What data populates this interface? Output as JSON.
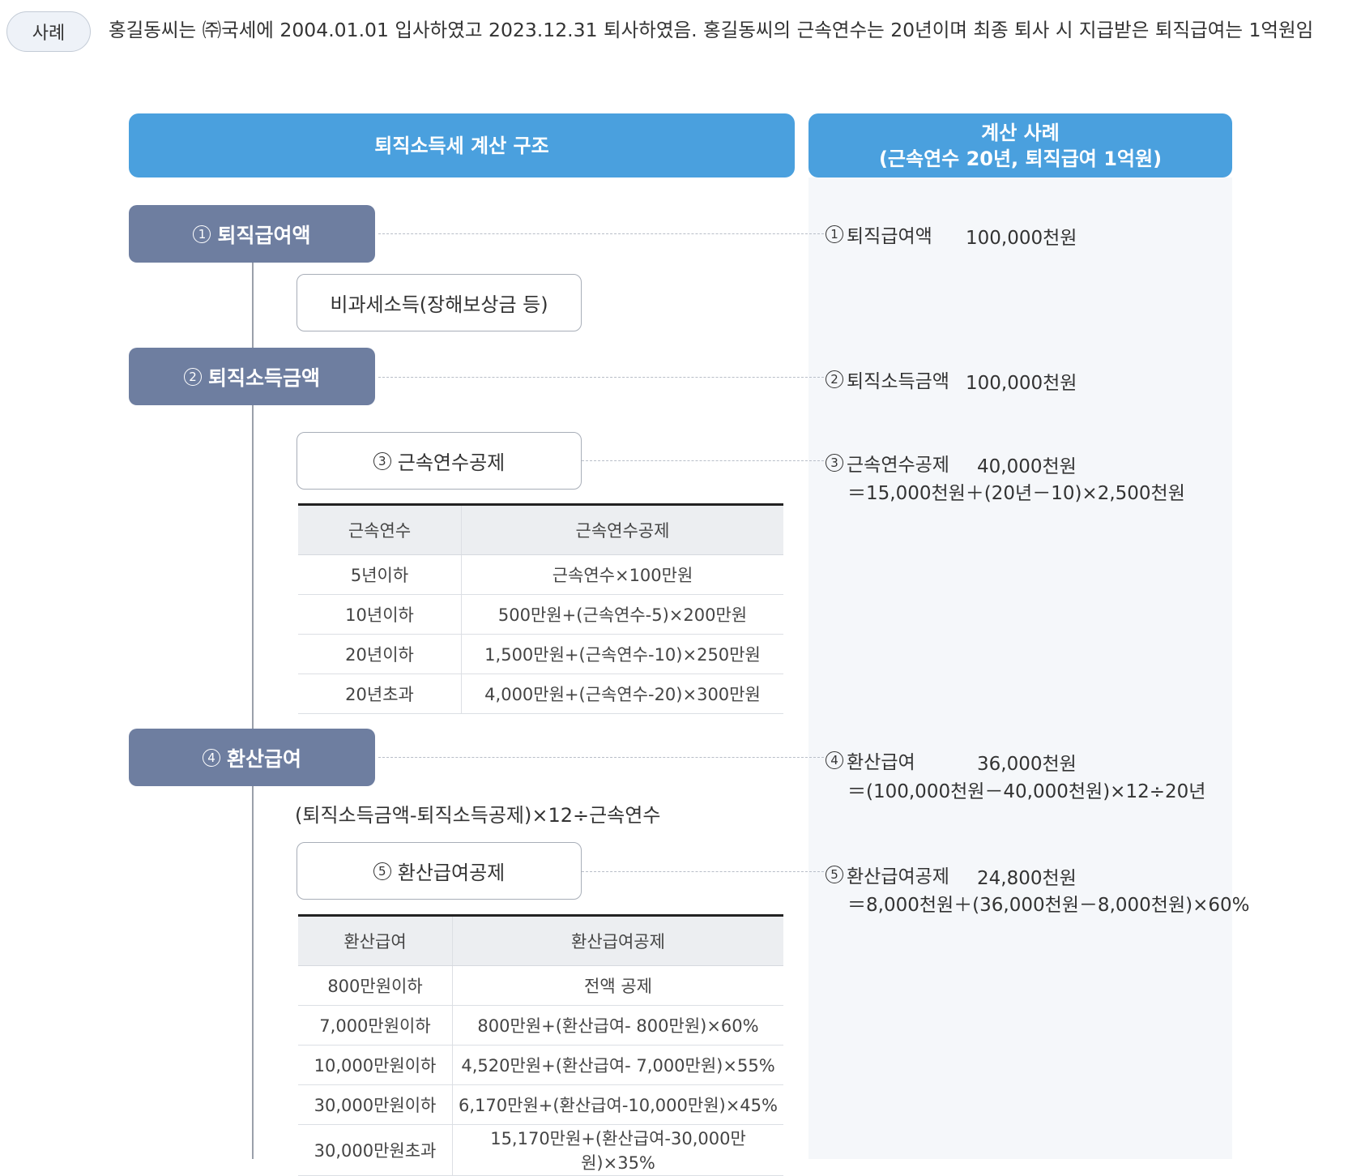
{
  "case": {
    "badge": "사례",
    "text": "홍길동씨는 ㈜국세에 2004.01.01 입사하였고 2023.12.31 퇴사하였음. 홍길동씨의 근속연수는 20년이며 최종 퇴사 시 지급받은 퇴직급여는 1억원임"
  },
  "headers": {
    "left": "퇴직소득세 계산 구조",
    "right_line1": "계산 사례",
    "right_line2": "(근속연수 20년, 퇴직급여 1억원)"
  },
  "steps": {
    "s1": {
      "num": "1",
      "label": "퇴직급여액"
    },
    "nontax": {
      "label": "비과세소득(장해보상금 등)"
    },
    "s2": {
      "num": "2",
      "label": "퇴직소득금액"
    },
    "s3": {
      "num": "3",
      "label": "근속연수공제"
    },
    "s4": {
      "num": "4",
      "label": "환산급여"
    },
    "s4_formula": "(퇴직소득금액-퇴직소득공제)×12÷근속연수",
    "s5": {
      "num": "5",
      "label": "환산급여공제"
    }
  },
  "example": {
    "e1": {
      "num": "1",
      "label": "퇴직급여액",
      "value": "100,000천원"
    },
    "e2": {
      "num": "2",
      "label": "퇴직소득금액",
      "value": "100,000천원"
    },
    "e3": {
      "num": "3",
      "label": "근속연수공제",
      "value": "40,000천원",
      "formula": "＝15,000천원＋(20년－10)×2,500천원"
    },
    "e4": {
      "num": "4",
      "label": "환산급여",
      "value": "36,000천원",
      "formula": "＝(100,000천원－40,000천원)×12÷20년"
    },
    "e5": {
      "num": "5",
      "label": "환산급여공제",
      "value": "24,800천원",
      "formula": "＝8,000천원＋(36,000천원－8,000천원)×60%"
    }
  },
  "table1": {
    "headers": [
      "근속연수",
      "근속연수공제"
    ],
    "rows": [
      [
        "5년이하",
        "근속연수×100만원"
      ],
      [
        "10년이하",
        "500만원+(근속연수-5)×200만원"
      ],
      [
        "20년이하",
        "1,500만원+(근속연수-10)×250만원"
      ],
      [
        "20년초과",
        "4,000만원+(근속연수-20)×300만원"
      ]
    ]
  },
  "table2": {
    "headers": [
      "환산급여",
      "환산급여공제"
    ],
    "rows": [
      [
        "800만원이하",
        "전액 공제"
      ],
      [
        "7,000만원이하",
        "800만원+(환산급여- 800만원)×60%"
      ],
      [
        "10,000만원이하",
        "4,520만원+(환산급여- 7,000만원)×55%"
      ],
      [
        "30,000만원이하",
        "6,170만원+(환산급여-10,000만원)×45%"
      ],
      [
        "30,000만원초과",
        "15,170만원+(환산급여-30,000만원)×35%"
      ]
    ]
  }
}
